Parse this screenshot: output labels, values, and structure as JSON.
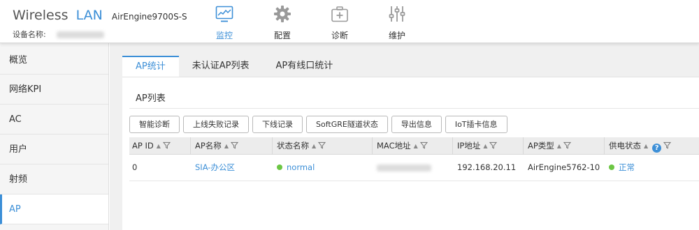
{
  "header": {
    "brand_word": "Wireless",
    "brand_lan": "LAN",
    "model": "AirEngine9700S-S",
    "device_name_label": "设备名称:",
    "nav": [
      {
        "label": "监控",
        "icon": "monitor-icon",
        "active": true
      },
      {
        "label": "配置",
        "icon": "gear-icon",
        "active": false
      },
      {
        "label": "诊断",
        "icon": "medical-kit-icon",
        "active": false
      },
      {
        "label": "维护",
        "icon": "sliders-icon",
        "active": false
      }
    ]
  },
  "sidebar": {
    "items": [
      {
        "label": "概览"
      },
      {
        "label": "网络KPI"
      },
      {
        "label": "AC"
      },
      {
        "label": "用户"
      },
      {
        "label": "射频"
      },
      {
        "label": "AP"
      }
    ],
    "active_index": 5
  },
  "tabs": [
    "AP统计",
    "未认证AP列表",
    "AP有线口统计"
  ],
  "panel": {
    "title": "AP列表",
    "buttons": [
      "智能诊断",
      "上线失败记录",
      "下线记录",
      "SoftGRE隧道状态",
      "导出信息",
      "IoT插卡信息"
    ]
  },
  "table": {
    "columns": [
      "AP ID",
      "AP名称",
      "状态名称",
      "MAC地址",
      "IP地址",
      "AP类型",
      "供电状态"
    ],
    "rows": [
      {
        "ap_id": "0",
        "ap_name": "SIA-办公区",
        "status": "normal",
        "ip": "192.168.20.11",
        "ap_type": "AirEngine5762-10",
        "power": "正常"
      }
    ]
  },
  "colors": {
    "accent": "#3c8fd7",
    "status_ok": "#6cc644"
  }
}
